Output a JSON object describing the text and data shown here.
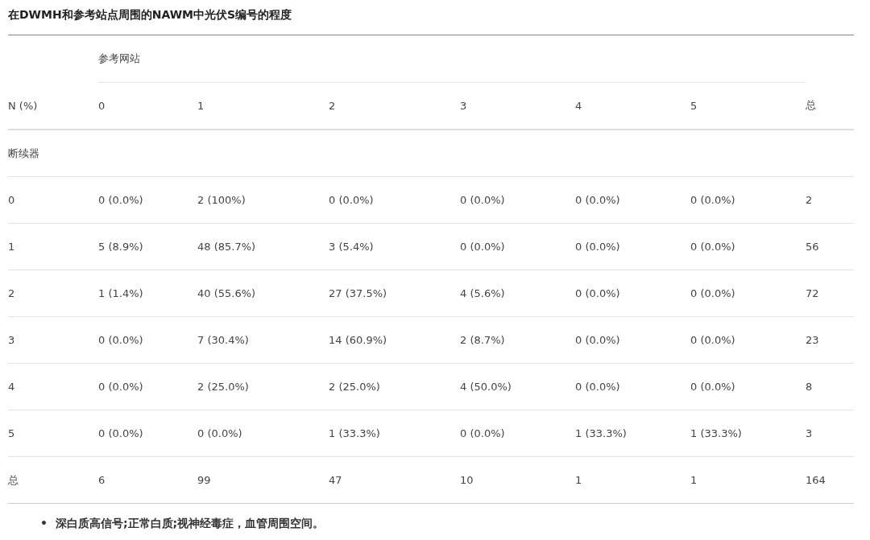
{
  "title": "在DWMH和参考站点周围的NAWM中光伏S编号的程度",
  "column_group": "参考网站",
  "columns": [
    "N (%)",
    "0",
    "1",
    "2",
    "3",
    "4",
    "5",
    "总"
  ],
  "section_label": "断续器",
  "rows": [
    [
      "0",
      "0 (0.0%)",
      "2 (100%)",
      "0 (0.0%)",
      "0 (0.0%)",
      "0 (0.0%)",
      "0 (0.0%)",
      "2"
    ],
    [
      "1",
      "5 (8.9%)",
      "48 (85.7%)",
      "3 (5.4%)",
      "0 (0.0%)",
      "0 (0.0%)",
      "0 (0.0%)",
      "56"
    ],
    [
      "2",
      "1 (1.4%)",
      "40 (55.6%)",
      "27 (37.5%)",
      "4 (5.6%)",
      "0 (0.0%)",
      "0 (0.0%)",
      "72"
    ],
    [
      "3",
      "0 (0.0%)",
      "7 (30.4%)",
      "14 (60.9%)",
      "2 (8.7%)",
      "0 (0.0%)",
      "0 (0.0%)",
      "23"
    ],
    [
      "4",
      "0 (0.0%)",
      "2 (25.0%)",
      "2 (25.0%)",
      "4 (50.0%)",
      "0 (0.0%)",
      "0 (0.0%)",
      "8"
    ],
    [
      "5",
      "0 (0.0%)",
      "0 (0.0%)",
      "1 (33.3%)",
      "0 (0.0%)",
      "1 (33.3%)",
      "1 (33.3%)",
      "3"
    ],
    [
      "总",
      "6",
      "99",
      "47",
      "10",
      "1",
      "1",
      "164"
    ]
  ],
  "footnotes": [
    {
      "bullet": "•",
      "text": "深白质高信号;正常白质;视神经毒症，血管周围空间。"
    }
  ]
}
